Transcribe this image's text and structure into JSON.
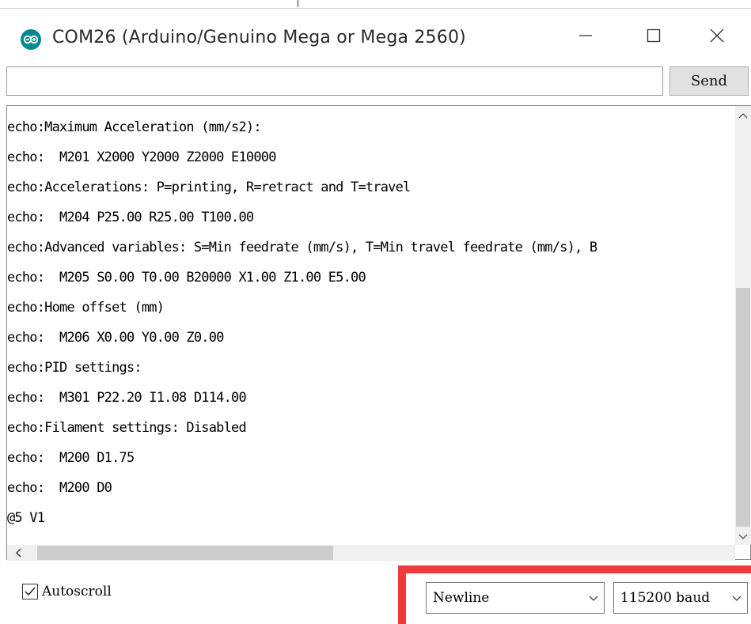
{
  "window": {
    "title": "COM26 (Arduino/Genuino Mega or Mega 2560)",
    "icon": "arduino-infinity-icon",
    "controls": [
      "minimize-icon",
      "maximize-icon",
      "close-icon"
    ]
  },
  "send_bar": {
    "input_value": "",
    "send_label": "Send"
  },
  "output": {
    "lines": [
      "echo:Maximum Acceleration (mm/s2):",
      "echo:  M201 X2000 Y2000 Z2000 E10000",
      "echo:Accelerations: P=printing, R=retract and T=travel",
      "echo:  M204 P25.00 R25.00 T100.00",
      "echo:Advanced variables: S=Min feedrate (mm/s), T=Min travel feedrate (mm/s), B",
      "echo:  M205 S0.00 T0.00 B20000 X1.00 Z1.00 E5.00",
      "echo:Home offset (mm)",
      "echo:  M206 X0.00 Y0.00 Z0.00",
      "echo:PID settings:",
      "echo:  M301 P22.20 I1.08 D114.00",
      "echo:Filament settings: Disabled",
      "echo:  M200 D1.75",
      "echo:  M200 D0",
      "@5 V1"
    ]
  },
  "footer": {
    "autoscroll_label": "Autoscroll",
    "autoscroll_checked": true,
    "line_ending_selected": "Newline",
    "baud_selected": "115200 baud"
  },
  "colors": {
    "highlight": "#ee3b3b",
    "arduino_teal": "#00878f"
  }
}
